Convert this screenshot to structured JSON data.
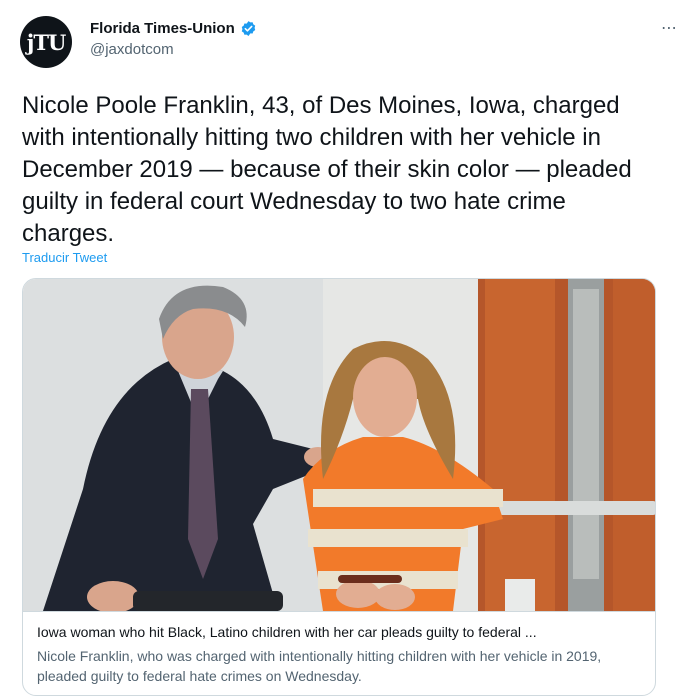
{
  "author": {
    "avatar_text": "jTU",
    "display_name": "Florida Times-Union",
    "handle": "@jaxdotcom",
    "verified": true
  },
  "more_icon": "⋯",
  "tweet": {
    "text": "Nicole Poole Franklin, 43, of Des Moines, Iowa, charged with intentionally hitting two children with her vehicle in December 2019 — because of their skin color — pleaded guilty in federal court Wednesday to two hate crime charges.",
    "translate_label": "Traducir Tweet"
  },
  "card": {
    "title": "Iowa woman who hit Black, Latino children with her car pleads guilty to federal ...",
    "description": "Nicole Franklin, who was charged with intentionally hitting children with her vehicle in 2019, pleaded guilty to federal hate crimes on Wednesday."
  },
  "colors": {
    "accent": "#1d9bf0",
    "text": "#0f1419",
    "secondary": "#536471",
    "border": "#cfd9de"
  }
}
